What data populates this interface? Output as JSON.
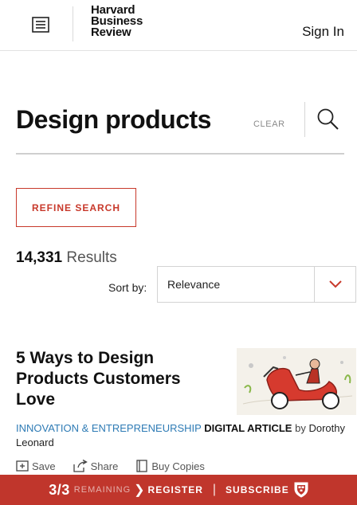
{
  "header": {
    "logo_lines": [
      "Harvard",
      "Business",
      "Review"
    ],
    "signin_label": "Sign In"
  },
  "search": {
    "query": "Design products",
    "clear_label": "CLEAR"
  },
  "refine_label": "REFINE SEARCH",
  "results": {
    "count": "14,331",
    "label": "Results"
  },
  "sort": {
    "label": "Sort by:",
    "selected": "Relevance"
  },
  "article": {
    "title": "5 Ways to Design Products Customers Love",
    "topic": "INNOVATION & ENTREPRENEURSHIP",
    "type": "DIGITAL ARTICLE",
    "by": "by",
    "author": "Dorothy Leonard",
    "actions": {
      "save": "Save",
      "share": "Share",
      "buy": "Buy Copies"
    }
  },
  "banner": {
    "meter": "3/3",
    "remaining": "REMAINING",
    "arrow": "❯",
    "register": "REGISTER",
    "separator": "|",
    "subscribe": "SUBSCRIBE"
  },
  "colors": {
    "accent": "#c8392b",
    "banner": "#c0362c",
    "topic_link": "#2e7bb5"
  }
}
